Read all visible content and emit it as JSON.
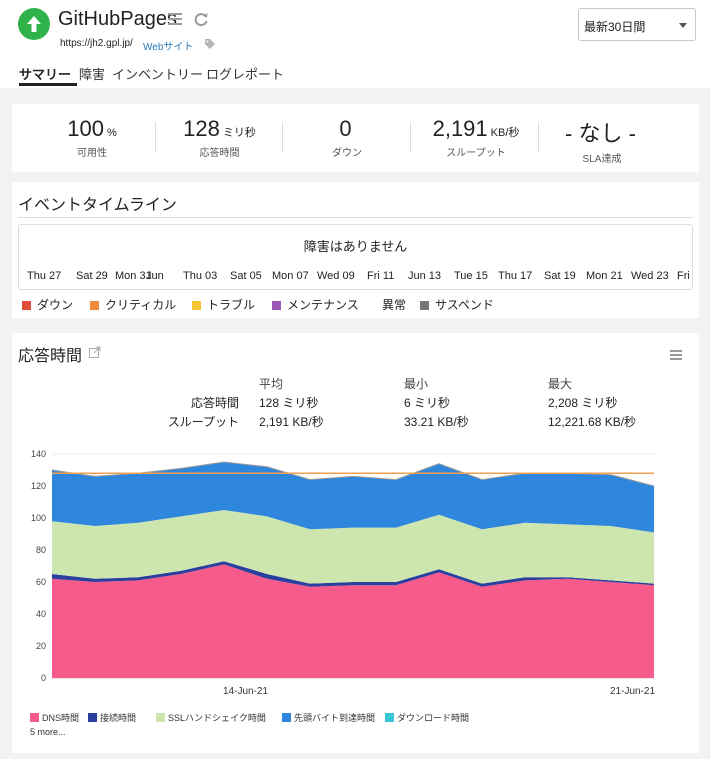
{
  "monitor": {
    "name": "GitHubPages",
    "url": "https://jh2.gpl.jp/",
    "type": "Webサイト",
    "status_color": "#2fb34a"
  },
  "period": {
    "selected": "最新30日間"
  },
  "tabs": [
    "サマリー",
    "障害",
    "インベントリー",
    "ログレポート"
  ],
  "metrics": [
    {
      "value": "100",
      "unit": "%",
      "label": "可用性"
    },
    {
      "value": "128",
      "unit": "ミリ秒",
      "label": "応答時間"
    },
    {
      "value": "0",
      "unit": "",
      "label": "ダウン"
    },
    {
      "value": "2,191",
      "unit": "KB/秒",
      "label": "スループット"
    },
    {
      "value": "- なし -",
      "unit": "",
      "label": "SLA達成"
    }
  ],
  "timeline": {
    "title": "イベントタイムライン",
    "message": "障害はありません",
    "dates": [
      "Thu 27",
      "Sat 29",
      "Mon 31",
      "Jun",
      "Thu 03",
      "Sat 05",
      "Mon 07",
      "Wed 09",
      "Fri 11",
      "Jun 13",
      "Tue 15",
      "Thu 17",
      "Sat 19",
      "Mon 21",
      "Wed 23",
      "Fri"
    ],
    "legend": [
      {
        "label": "ダウン",
        "color": "#e04b3a"
      },
      {
        "label": "クリティカル",
        "color": "#f08a3c"
      },
      {
        "label": "トラブル",
        "color": "#f4c431"
      },
      {
        "label": "メンテナンス",
        "color": "#9b59b6"
      },
      {
        "label": "異常",
        "color": ""
      },
      {
        "label": "サスペンド",
        "color": "#777777"
      }
    ]
  },
  "response": {
    "title": "応答時間",
    "stats": {
      "headers": [
        "平均",
        "最小",
        "最大"
      ],
      "rows": [
        {
          "label": "応答時間",
          "values": [
            "128 ミリ秒",
            "6 ミリ秒",
            "2,208 ミリ秒"
          ]
        },
        {
          "label": "スループット",
          "values": [
            "2,191 KB/秒",
            "33.21 KB/秒",
            "12,221.68 KB/秒"
          ]
        }
      ]
    },
    "more_label": "5 more..."
  },
  "chart_data": {
    "type": "area",
    "stacked": true,
    "ylim": [
      0,
      140
    ],
    "yticks": [
      0,
      20,
      40,
      60,
      80,
      100,
      120,
      140
    ],
    "x_tick_labels": [
      {
        "label": "14-Jun-21",
        "index": 4.5
      },
      {
        "label": "21-Jun-21",
        "index": 13.5
      }
    ],
    "average_line": {
      "value": 128,
      "color": "#f0a050"
    },
    "series": [
      {
        "name": "DNS時間",
        "color": "#f75b8c",
        "values": [
          62,
          60,
          61,
          65,
          71,
          62,
          57,
          58,
          58,
          66,
          57,
          61,
          62,
          60,
          58
        ]
      },
      {
        "name": "接続時間",
        "color": "#2a3f9e",
        "values": [
          3,
          2,
          2,
          2,
          2,
          3,
          2,
          2,
          2,
          2,
          2,
          2,
          1,
          1,
          1
        ]
      },
      {
        "name": "SSLハンドシェイク時間",
        "color": "#cde6b0",
        "values": [
          33,
          33,
          34,
          34,
          32,
          36,
          34,
          34,
          34,
          34,
          34,
          34,
          33,
          34,
          32
        ]
      },
      {
        "name": "先頭バイト到達時間",
        "color": "#2f86dd",
        "values": [
          32,
          31,
          31,
          30,
          30,
          31,
          31,
          32,
          30,
          32,
          31,
          31,
          32,
          32,
          29
        ]
      },
      {
        "name": "ダウンロード時間",
        "color": "#3bc6d6",
        "values": [
          0,
          0,
          0,
          0,
          0,
          0,
          0,
          0,
          0,
          0,
          0,
          0,
          0,
          0,
          0
        ]
      }
    ]
  }
}
